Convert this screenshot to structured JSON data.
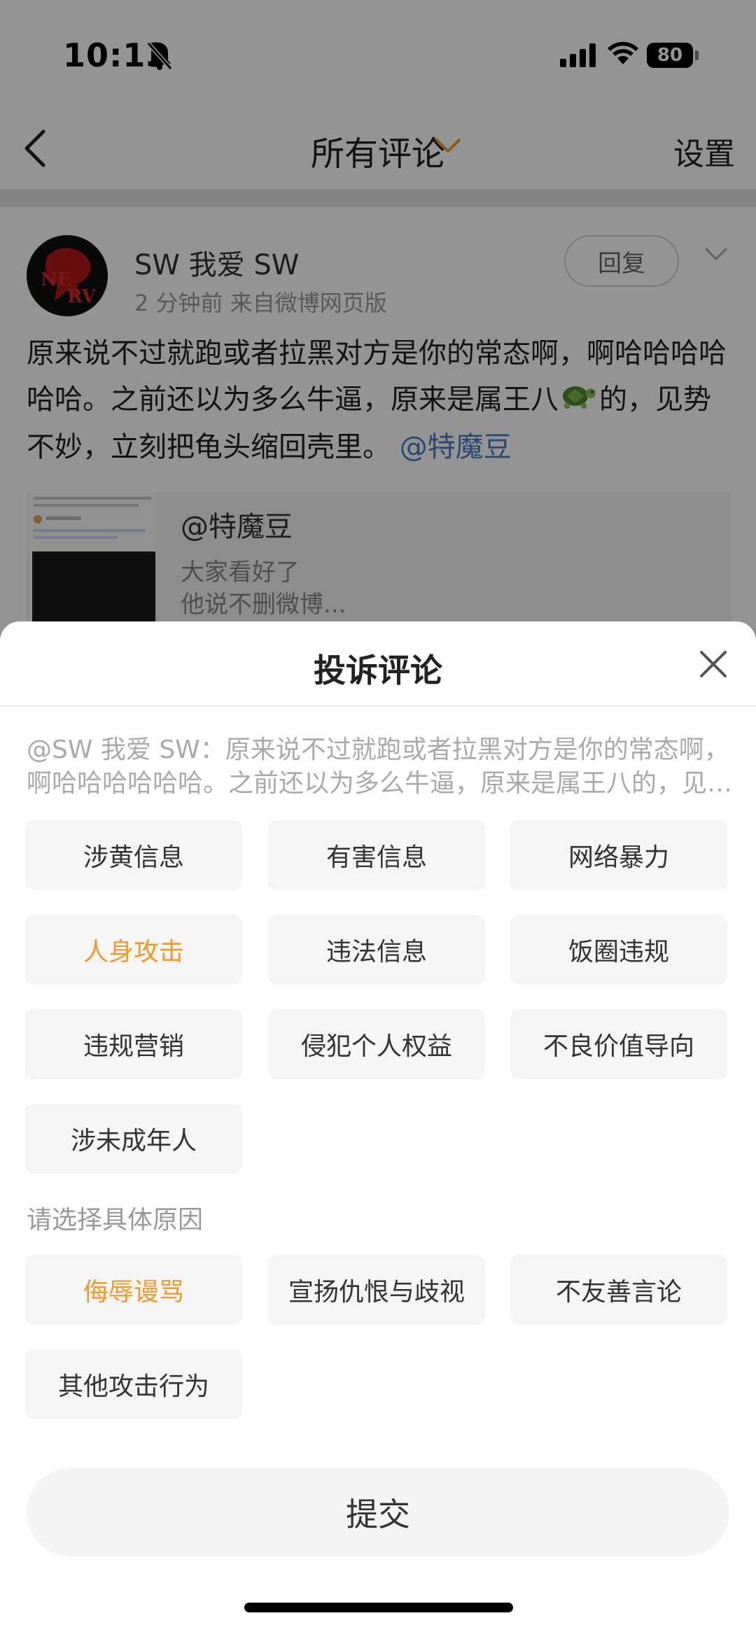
{
  "status_bar": {
    "time": "10:13",
    "battery": "80",
    "icons": [
      "bell-off-icon",
      "signal-icon",
      "wifi-icon",
      "battery-icon"
    ]
  },
  "navbar": {
    "title": "所有评论",
    "settings_label": "设置",
    "icons": [
      "back-icon",
      "chevron-down-icon"
    ]
  },
  "comment": {
    "author": "SW 我爱 SW",
    "meta": "2 分钟前   来自微博网页版",
    "reply_label": "回复",
    "text_part1": "原来说不过就跑或者拉黑对方是你的常态啊，啊哈哈哈哈哈哈。之前还以为多么牛逼，原来是属王八",
    "text_part2": "的，见势不妙，立刻把龟头缩回壳里。",
    "mention": "@特魔豆",
    "emoji": "turtle-icon",
    "avatar_text": "NERV",
    "quote": {
      "name": "@特魔豆",
      "line1": "大家看好了",
      "line2": "他说不删微博..."
    }
  },
  "sheet": {
    "title": "投诉评论",
    "quoted": "@SW 我爱 SW：原来说不过就跑或者拉黑对方是你的常态啊，啊哈哈哈哈哈哈。之前还以为多么牛逼，原来是属王八的，见势不妙，立刻把龟头缩回壳里。",
    "categories": [
      "涉黄信息",
      "有害信息",
      "网络暴力",
      "人身攻击",
      "违法信息",
      "饭圈违规",
      "违规营销",
      "侵犯个人权益",
      "不良价值导向",
      "涉未成年人"
    ],
    "selected_category": "人身攻击",
    "reason_heading": "请选择具体原因",
    "reasons": [
      "侮辱谩骂",
      "宣扬仇恨与歧视",
      "不友善言论",
      "其他攻击行为"
    ],
    "selected_reason": "侮辱谩骂",
    "submit_label": "提交",
    "accent_color": "#f09a2c"
  }
}
